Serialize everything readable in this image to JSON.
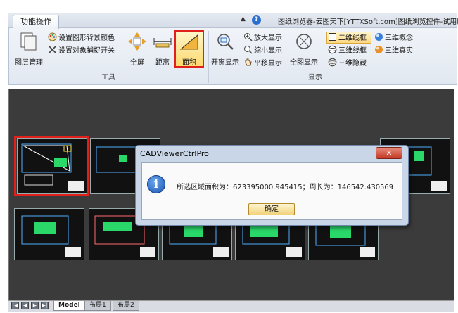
{
  "ribbon": {
    "tab_label": "功能操作",
    "window_title": "图纸浏览器-云图天下[YTTXSoft.com]图纸浏览控件-试用版",
    "groups": {
      "tools_label": "工具",
      "display_label": "显示"
    },
    "buttons": {
      "layer_manager": "图层管理",
      "set_bg_color": "设置图形背景颜色",
      "set_snap": "设置对象捕捉开关",
      "fullscreen": "全屏",
      "distance": "距离",
      "area": "面积",
      "window_display": "开窗显示",
      "zoom_in": "放大显示",
      "zoom_out": "缩小显示",
      "pan": "平移显示",
      "full_display": "全图显示",
      "wireframe_2d": "二维线框",
      "concept_3d": "三维概念",
      "wireframe_3d": "三维线框",
      "realistic_3d": "三维真实",
      "hidden_3d": "三维隐藏"
    }
  },
  "layout_tabs": [
    "Model",
    "布局1",
    "布局2"
  ],
  "dialog": {
    "title": "CADViewerCtrlPro",
    "close_label": "✕",
    "message": "所选区域面积为：623395000.945415；周长为：146542.430569",
    "ok_label": "确定"
  },
  "colors": {
    "highlight_border": "#e0201a",
    "canvas_bg": "#3b3b3b",
    "dialog_bg": "#c8d6e8"
  }
}
